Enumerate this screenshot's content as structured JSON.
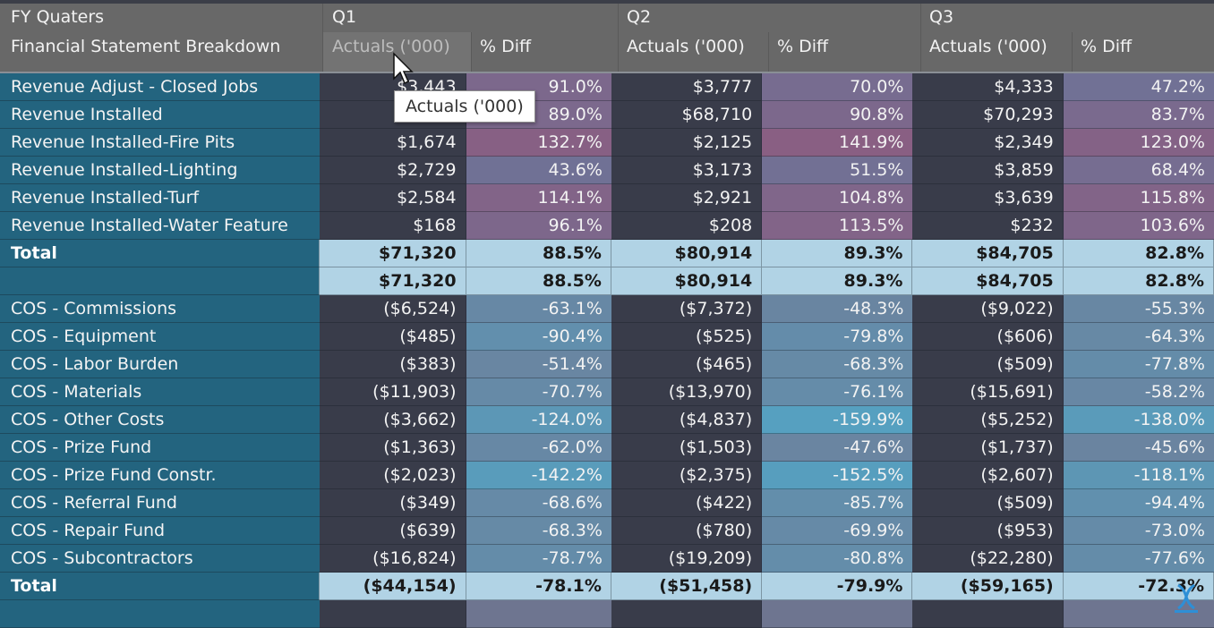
{
  "header": {
    "row_group_label": "FY Quaters",
    "row_field_label": "Financial Statement Breakdown",
    "quarters": [
      {
        "label": "Q1",
        "actuals_label": "Actuals ('000)",
        "diff_label": "% Diff"
      },
      {
        "label": "Q2",
        "actuals_label": "Actuals ('000)",
        "diff_label": "% Diff"
      },
      {
        "label": "Q3",
        "actuals_label": "Actuals ('000)",
        "diff_label": "% Diff"
      }
    ]
  },
  "tooltip": {
    "text": "Actuals ('000)"
  },
  "colors": {
    "header_bg": "#686868",
    "label_bg": "#23647f",
    "actuals_bg": "#393c4a",
    "total_bg": "#b1d3e5",
    "positive_high": "#8a5e82",
    "positive_low": "#6f7296",
    "negative_high": "#56a0c0",
    "negative_low": "#6a84a0"
  },
  "revenue_rows": [
    {
      "label": "Revenue Adjust - Closed Jobs",
      "q1_act": "$3,443",
      "q1_pct": "91.0%",
      "q2_act": "$3,777",
      "q2_pct": "70.0%",
      "q3_act": "$4,333",
      "q3_pct": "47.2%"
    },
    {
      "label": "Revenue Installed",
      "q1_act": "",
      "q1_pct": "89.0%",
      "q2_act": "$68,710",
      "q2_pct": "90.8%",
      "q3_act": "$70,293",
      "q3_pct": "83.7%"
    },
    {
      "label": "Revenue Installed-Fire Pits",
      "q1_act": "$1,674",
      "q1_pct": "132.7%",
      "q2_act": "$2,125",
      "q2_pct": "141.9%",
      "q3_act": "$2,349",
      "q3_pct": "123.0%"
    },
    {
      "label": "Revenue Installed-Lighting",
      "q1_act": "$2,729",
      "q1_pct": "43.6%",
      "q2_act": "$3,173",
      "q2_pct": "51.5%",
      "q3_act": "$3,859",
      "q3_pct": "68.4%"
    },
    {
      "label": "Revenue Installed-Turf",
      "q1_act": "$2,584",
      "q1_pct": "114.1%",
      "q2_act": "$2,921",
      "q2_pct": "104.8%",
      "q3_act": "$3,639",
      "q3_pct": "115.8%"
    },
    {
      "label": "Revenue Installed-Water Feature",
      "q1_act": "$168",
      "q1_pct": "96.1%",
      "q2_act": "$208",
      "q2_pct": "113.5%",
      "q3_act": "$232",
      "q3_pct": "103.6%"
    }
  ],
  "revenue_total": {
    "label": "Total",
    "q1_act": "$71,320",
    "q1_pct": "88.5%",
    "q2_act": "$80,914",
    "q2_pct": "89.3%",
    "q3_act": "$84,705",
    "q3_pct": "82.8%"
  },
  "revenue_subtotal": {
    "label": "",
    "q1_act": "$71,320",
    "q1_pct": "88.5%",
    "q2_act": "$80,914",
    "q2_pct": "89.3%",
    "q3_act": "$84,705",
    "q3_pct": "82.8%"
  },
  "cos_rows": [
    {
      "label": "COS - Commissions",
      "q1_act": "($6,524)",
      "q1_pct": "-63.1%",
      "q2_act": "($7,372)",
      "q2_pct": "-48.3%",
      "q3_act": "($9,022)",
      "q3_pct": "-55.3%"
    },
    {
      "label": "COS - Equipment",
      "q1_act": "($485)",
      "q1_pct": "-90.4%",
      "q2_act": "($525)",
      "q2_pct": "-79.8%",
      "q3_act": "($606)",
      "q3_pct": "-64.3%"
    },
    {
      "label": "COS - Labor Burden",
      "q1_act": "($383)",
      "q1_pct": "-51.4%",
      "q2_act": "($465)",
      "q2_pct": "-68.3%",
      "q3_act": "($509)",
      "q3_pct": "-77.8%"
    },
    {
      "label": "COS - Materials",
      "q1_act": "($11,903)",
      "q1_pct": "-70.7%",
      "q2_act": "($13,970)",
      "q2_pct": "-76.1%",
      "q3_act": "($15,691)",
      "q3_pct": "-58.2%"
    },
    {
      "label": "COS - Other Costs",
      "q1_act": "($3,662)",
      "q1_pct": "-124.0%",
      "q2_act": "($4,837)",
      "q2_pct": "-159.9%",
      "q3_act": "($5,252)",
      "q3_pct": "-138.0%"
    },
    {
      "label": "COS - Prize Fund",
      "q1_act": "($1,363)",
      "q1_pct": "-62.0%",
      "q2_act": "($1,503)",
      "q2_pct": "-47.6%",
      "q3_act": "($1,737)",
      "q3_pct": "-45.6%"
    },
    {
      "label": "COS - Prize Fund Constr.",
      "q1_act": "($2,023)",
      "q1_pct": "-142.2%",
      "q2_act": "($2,375)",
      "q2_pct": "-152.5%",
      "q3_act": "($2,607)",
      "q3_pct": "-118.1%"
    },
    {
      "label": "COS - Referral Fund",
      "q1_act": "($349)",
      "q1_pct": "-68.6%",
      "q2_act": "($422)",
      "q2_pct": "-85.7%",
      "q3_act": "($509)",
      "q3_pct": "-94.4%"
    },
    {
      "label": "COS - Repair Fund",
      "q1_act": "($639)",
      "q1_pct": "-68.3%",
      "q2_act": "($780)",
      "q2_pct": "-69.9%",
      "q3_act": "($953)",
      "q3_pct": "-73.0%"
    },
    {
      "label": "COS - Subcontractors",
      "q1_act": "($16,824)",
      "q1_pct": "-78.7%",
      "q2_act": "($19,209)",
      "q2_pct": "-80.8%",
      "q3_act": "($22,280)",
      "q3_pct": "-77.6%"
    }
  ],
  "cos_total": {
    "label": "Total",
    "q1_act": "($44,154)",
    "q1_pct": "-78.1%",
    "q2_act": "($51,458)",
    "q2_pct": "-79.9%",
    "q3_act": "($59,165)",
    "q3_pct": "-72.3%"
  }
}
